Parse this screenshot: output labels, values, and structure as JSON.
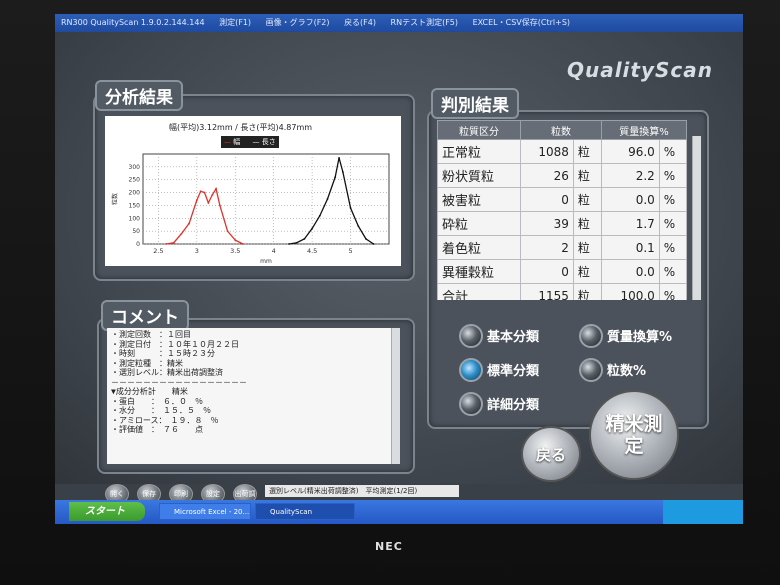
{
  "window": {
    "title": "RN300 QualityScan 1.9.0.2.144.144",
    "menu": [
      "測定(F1)",
      "画像・グラフ(F2)",
      "戻る(F4)",
      "RNテスト測定(F5)",
      "EXCEL・CSV保存(Ctrl+S)"
    ]
  },
  "logo": "QualityScan",
  "analysis": {
    "heading": "分析結果",
    "chart_title": "幅(平均)3.12mm  /  長さ(平均)4.87mm",
    "legend": [
      "幅",
      "長さ"
    ],
    "xlabel": "mm",
    "ylabel": "粒数"
  },
  "chart_data": {
    "type": "line",
    "title": "幅(平均)3.12mm  /  長さ(平均)4.87mm",
    "xlabel": "mm",
    "ylabel": "粒数",
    "xlim": [
      2.3,
      5.5
    ],
    "ylim": [
      0,
      350
    ],
    "xticks": [
      "2.5",
      "3",
      "3.5",
      "4",
      "4.5",
      "5"
    ],
    "yticks": [
      "0",
      "50",
      "100",
      "150",
      "200",
      "250",
      "300"
    ],
    "grid": true,
    "legend_placement": "top-center",
    "series": [
      {
        "name": "幅",
        "color": "#e0322a",
        "x": [
          2.6,
          2.7,
          2.8,
          2.9,
          3.0,
          3.05,
          3.1,
          3.15,
          3.2,
          3.25,
          3.3,
          3.4,
          3.5,
          3.6
        ],
        "y": [
          0,
          5,
          40,
          80,
          170,
          205,
          200,
          160,
          190,
          215,
          150,
          50,
          15,
          0
        ]
      },
      {
        "name": "長さ",
        "color": "#111111",
        "x": [
          4.2,
          4.3,
          4.4,
          4.5,
          4.6,
          4.7,
          4.8,
          4.85,
          4.9,
          5.0,
          5.1,
          5.2,
          5.3
        ],
        "y": [
          0,
          5,
          20,
          60,
          110,
          175,
          260,
          335,
          280,
          140,
          70,
          20,
          0
        ]
      }
    ]
  },
  "results": {
    "heading": "判別結果",
    "columns": [
      "粒質区分",
      "粒数",
      "質量換算%"
    ],
    "rows": [
      [
        "正常粒",
        "1088",
        "粒",
        "96.0",
        "%"
      ],
      [
        "粉状質粒",
        "26",
        "粒",
        "2.2",
        "%"
      ],
      [
        "被害粒",
        "0",
        "粒",
        "0.0",
        "%"
      ],
      [
        "砕粒",
        "39",
        "粒",
        "1.7",
        "%"
      ],
      [
        "着色粒",
        "2",
        "粒",
        "0.1",
        "%"
      ],
      [
        "異種穀粒",
        "0",
        "粒",
        "0.0",
        "%"
      ],
      [
        "合計",
        "1155",
        "粒",
        "100.0",
        "%"
      ]
    ]
  },
  "comment": {
    "heading": "コメント",
    "lines": [
      "・測定回数　：１回目",
      "・測定日付　：１０年１０月２２日",
      "・時刻　　　：１５時２３分",
      "・測定粒種　：精米",
      "・選別レベル：精米出荷調整済",
      "－－－－－－－－－－－－－－－－－",
      "▼成分分析計　　精米",
      "・蛋白　　：　６．０　％",
      "・水分　　：　１５．５　％",
      "・アミロース：　１９．８　％",
      "・評価値　：　７６　　点"
    ]
  },
  "options": {
    "classification": [
      "基本分類",
      "標準分類",
      "詳細分類"
    ],
    "selected_classification": "標準分類",
    "unit": [
      "質量換算%",
      "粒数%"
    ]
  },
  "buttons": {
    "back": "戻る",
    "measure": "精米測定",
    "small": [
      "開く",
      "保存",
      "印刷",
      "設定",
      "出荷調"
    ]
  },
  "status": "選別レベル(精米出荷調整済)　平均測定(1/2回)",
  "taskbar": {
    "start": "スタート",
    "tasks": [
      "Microsoft Excel - 20...",
      "QualityScan"
    ]
  },
  "monitor_brand": "NEC"
}
